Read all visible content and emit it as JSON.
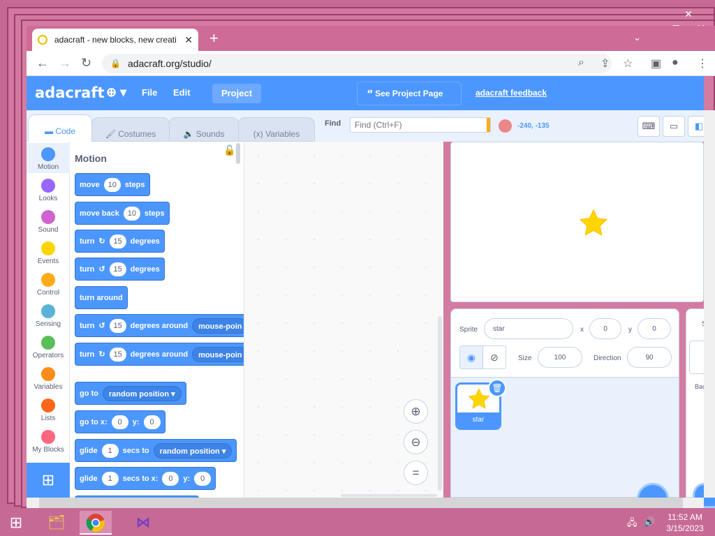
{
  "browser": {
    "tab_title": "adacraft - new blocks, new creati",
    "url": "adacraft.org/studio/"
  },
  "menubar": {
    "logo": "adacraft",
    "file": "File",
    "edit": "Edit",
    "project": "Project",
    "see_project": "See Project Page",
    "feedback": "adacraft feedback"
  },
  "editor_tabs": {
    "code": "Code",
    "costumes": "Costumes",
    "sounds": "Sounds",
    "variables": "Variables"
  },
  "find": {
    "label": "Find",
    "placeholder": "Find (Ctrl+F)"
  },
  "stage_coords": "-240, -135",
  "categories": [
    {
      "label": "Motion",
      "color": "#4c97ff"
    },
    {
      "label": "Looks",
      "color": "#9966ff"
    },
    {
      "label": "Sound",
      "color": "#cf63cf"
    },
    {
      "label": "Events",
      "color": "#ffd500"
    },
    {
      "label": "Control",
      "color": "#ffab19"
    },
    {
      "label": "Sensing",
      "color": "#5cb1d6"
    },
    {
      "label": "Operators",
      "color": "#59c059"
    },
    {
      "label": "Variables",
      "color": "#ff8c1a"
    },
    {
      "label": "Lists",
      "color": "#ff661a"
    },
    {
      "label": "My Blocks",
      "color": "#ff6680"
    }
  ],
  "palette": {
    "title": "Motion",
    "blocks": {
      "b1": {
        "a": "move",
        "v1": "10",
        "b": "steps"
      },
      "b2": {
        "a": "move back",
        "v1": "10",
        "b": "steps"
      },
      "b3": {
        "a": "turn",
        "v1": "15",
        "b": "degrees"
      },
      "b4": {
        "a": "turn",
        "v1": "15",
        "b": "degrees"
      },
      "b5": {
        "a": "turn around"
      },
      "b6": {
        "a": "turn",
        "v1": "15",
        "b": "degrees around",
        "dd": "mouse-poin"
      },
      "b7": {
        "a": "turn",
        "v1": "15",
        "b": "degrees around",
        "dd": "mouse-poin"
      },
      "b8": {
        "a": "go to",
        "dd": "random position"
      },
      "b9": {
        "a": "go to x:",
        "v1": "0",
        "b": "y:",
        "v2": "0"
      },
      "b10": {
        "a": "glide",
        "v1": "1",
        "b": "secs to",
        "dd": "random position"
      },
      "b11": {
        "a": "glide",
        "v1": "1",
        "b": "secs to x:",
        "v2": "0",
        "c": "y:",
        "v3": "0"
      }
    }
  },
  "sprite_info": {
    "sprite_label": "Sprite",
    "sprite_name": "star",
    "x_label": "x",
    "x": "0",
    "y_label": "y",
    "y": "0",
    "size_label": "Size",
    "size": "100",
    "direction_label": "Direction",
    "direction": "90"
  },
  "sprite_tile": {
    "name": "star"
  },
  "backdrop_partial": {
    "label": "Bac",
    "stage_label": "S"
  },
  "taskbar": {
    "time": "11:52 AM",
    "date": "3/15/2023"
  },
  "colors": {
    "accent": "#4c97ff",
    "desktop": "#c66a95",
    "star": "#ffd500"
  }
}
